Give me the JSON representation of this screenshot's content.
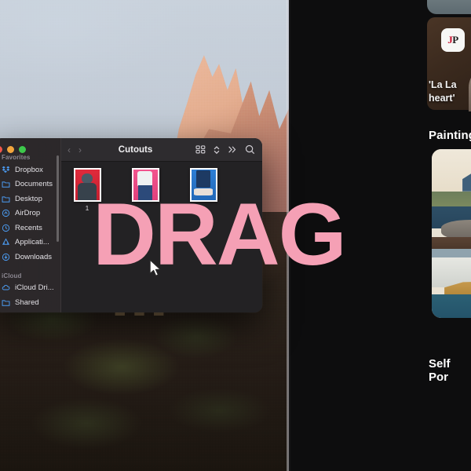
{
  "overlay": {
    "word": "DRAG",
    "color": "#f5a0b5"
  },
  "finder": {
    "title": "Cutouts",
    "nav": {
      "back": "‹",
      "forward": "›"
    },
    "toolbar_icons": [
      {
        "name": "grid-view-icon"
      },
      {
        "name": "view-stepper-icon"
      },
      {
        "name": "more-chevrons-icon",
        "glyph": "»"
      },
      {
        "name": "search-icon"
      }
    ],
    "sidebar": {
      "groups": [
        {
          "label": "Favorites",
          "items": [
            {
              "label": "Dropbox",
              "icon": "dropbox-icon"
            },
            {
              "label": "Documents",
              "icon": "folder-icon"
            },
            {
              "label": "Desktop",
              "icon": "folder-icon"
            },
            {
              "label": "AirDrop",
              "icon": "airdrop-icon"
            },
            {
              "label": "Recents",
              "icon": "clock-icon"
            },
            {
              "label": "Applicati...",
              "icon": "applications-icon"
            },
            {
              "label": "Downloads",
              "icon": "downloads-icon"
            }
          ]
        },
        {
          "label": "iCloud",
          "items": [
            {
              "label": "iCloud Dri...",
              "icon": "cloud-icon"
            },
            {
              "label": "Shared",
              "icon": "shared-folder-icon"
            }
          ]
        }
      ]
    },
    "files": [
      {
        "label": "1",
        "thumb": "red-portrait-cutout"
      },
      {
        "label": "",
        "thumb": "pink-tshirt-cutout"
      },
      {
        "label": "",
        "thumb": "blue-sneakers-cutout"
      }
    ]
  },
  "app_panel": {
    "news": {
      "badge_j": "J",
      "badge_p": "P",
      "headline": "'La La\nheart'"
    },
    "section_title": "Painting",
    "artwork_caption": "Self Por"
  }
}
